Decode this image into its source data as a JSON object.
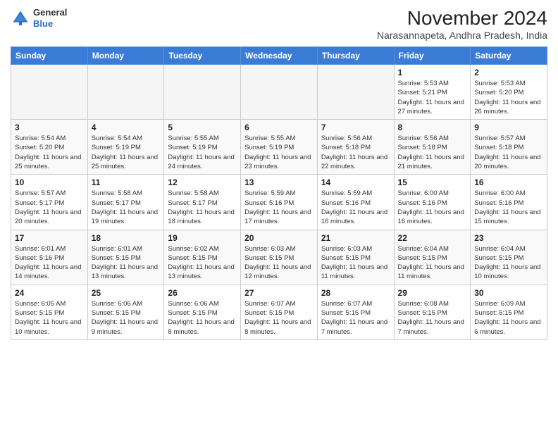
{
  "header": {
    "logo": {
      "general": "General",
      "blue": "Blue"
    },
    "month_title": "November 2024",
    "location": "Narasannapeta, Andhra Pradesh, India"
  },
  "weekdays": [
    "Sunday",
    "Monday",
    "Tuesday",
    "Wednesday",
    "Thursday",
    "Friday",
    "Saturday"
  ],
  "weeks": [
    [
      {
        "day": "",
        "sunrise": "",
        "sunset": "",
        "daylight": "",
        "empty": true
      },
      {
        "day": "",
        "sunrise": "",
        "sunset": "",
        "daylight": "",
        "empty": true
      },
      {
        "day": "",
        "sunrise": "",
        "sunset": "",
        "daylight": "",
        "empty": true
      },
      {
        "day": "",
        "sunrise": "",
        "sunset": "",
        "daylight": "",
        "empty": true
      },
      {
        "day": "",
        "sunrise": "",
        "sunset": "",
        "daylight": "",
        "empty": true
      },
      {
        "day": "1",
        "sunrise": "Sunrise: 5:53 AM",
        "sunset": "Sunset: 5:21 PM",
        "daylight": "Daylight: 11 hours and 27 minutes.",
        "empty": false
      },
      {
        "day": "2",
        "sunrise": "Sunrise: 5:53 AM",
        "sunset": "Sunset: 5:20 PM",
        "daylight": "Daylight: 11 hours and 26 minutes.",
        "empty": false
      }
    ],
    [
      {
        "day": "3",
        "sunrise": "Sunrise: 5:54 AM",
        "sunset": "Sunset: 5:20 PM",
        "daylight": "Daylight: 11 hours and 25 minutes.",
        "empty": false
      },
      {
        "day": "4",
        "sunrise": "Sunrise: 5:54 AM",
        "sunset": "Sunset: 5:19 PM",
        "daylight": "Daylight: 11 hours and 25 minutes.",
        "empty": false
      },
      {
        "day": "5",
        "sunrise": "Sunrise: 5:55 AM",
        "sunset": "Sunset: 5:19 PM",
        "daylight": "Daylight: 11 hours and 24 minutes.",
        "empty": false
      },
      {
        "day": "6",
        "sunrise": "Sunrise: 5:55 AM",
        "sunset": "Sunset: 5:19 PM",
        "daylight": "Daylight: 11 hours and 23 minutes.",
        "empty": false
      },
      {
        "day": "7",
        "sunrise": "Sunrise: 5:56 AM",
        "sunset": "Sunset: 5:18 PM",
        "daylight": "Daylight: 11 hours and 22 minutes.",
        "empty": false
      },
      {
        "day": "8",
        "sunrise": "Sunrise: 5:56 AM",
        "sunset": "Sunset: 5:18 PM",
        "daylight": "Daylight: 11 hours and 21 minutes.",
        "empty": false
      },
      {
        "day": "9",
        "sunrise": "Sunrise: 5:57 AM",
        "sunset": "Sunset: 5:18 PM",
        "daylight": "Daylight: 11 hours and 20 minutes.",
        "empty": false
      }
    ],
    [
      {
        "day": "10",
        "sunrise": "Sunrise: 5:57 AM",
        "sunset": "Sunset: 5:17 PM",
        "daylight": "Daylight: 11 hours and 20 minutes.",
        "empty": false
      },
      {
        "day": "11",
        "sunrise": "Sunrise: 5:58 AM",
        "sunset": "Sunset: 5:17 PM",
        "daylight": "Daylight: 11 hours and 19 minutes.",
        "empty": false
      },
      {
        "day": "12",
        "sunrise": "Sunrise: 5:58 AM",
        "sunset": "Sunset: 5:17 PM",
        "daylight": "Daylight: 11 hours and 18 minutes.",
        "empty": false
      },
      {
        "day": "13",
        "sunrise": "Sunrise: 5:59 AM",
        "sunset": "Sunset: 5:16 PM",
        "daylight": "Daylight: 11 hours and 17 minutes.",
        "empty": false
      },
      {
        "day": "14",
        "sunrise": "Sunrise: 5:59 AM",
        "sunset": "Sunset: 5:16 PM",
        "daylight": "Daylight: 11 hours and 16 minutes.",
        "empty": false
      },
      {
        "day": "15",
        "sunrise": "Sunrise: 6:00 AM",
        "sunset": "Sunset: 5:16 PM",
        "daylight": "Daylight: 11 hours and 16 minutes.",
        "empty": false
      },
      {
        "day": "16",
        "sunrise": "Sunrise: 6:00 AM",
        "sunset": "Sunset: 5:16 PM",
        "daylight": "Daylight: 11 hours and 15 minutes.",
        "empty": false
      }
    ],
    [
      {
        "day": "17",
        "sunrise": "Sunrise: 6:01 AM",
        "sunset": "Sunset: 5:16 PM",
        "daylight": "Daylight: 11 hours and 14 minutes.",
        "empty": false
      },
      {
        "day": "18",
        "sunrise": "Sunrise: 6:01 AM",
        "sunset": "Sunset: 5:15 PM",
        "daylight": "Daylight: 11 hours and 13 minutes.",
        "empty": false
      },
      {
        "day": "19",
        "sunrise": "Sunrise: 6:02 AM",
        "sunset": "Sunset: 5:15 PM",
        "daylight": "Daylight: 11 hours and 13 minutes.",
        "empty": false
      },
      {
        "day": "20",
        "sunrise": "Sunrise: 6:03 AM",
        "sunset": "Sunset: 5:15 PM",
        "daylight": "Daylight: 11 hours and 12 minutes.",
        "empty": false
      },
      {
        "day": "21",
        "sunrise": "Sunrise: 6:03 AM",
        "sunset": "Sunset: 5:15 PM",
        "daylight": "Daylight: 11 hours and 11 minutes.",
        "empty": false
      },
      {
        "day": "22",
        "sunrise": "Sunrise: 6:04 AM",
        "sunset": "Sunset: 5:15 PM",
        "daylight": "Daylight: 11 hours and 11 minutes.",
        "empty": false
      },
      {
        "day": "23",
        "sunrise": "Sunrise: 6:04 AM",
        "sunset": "Sunset: 5:15 PM",
        "daylight": "Daylight: 11 hours and 10 minutes.",
        "empty": false
      }
    ],
    [
      {
        "day": "24",
        "sunrise": "Sunrise: 6:05 AM",
        "sunset": "Sunset: 5:15 PM",
        "daylight": "Daylight: 11 hours and 10 minutes.",
        "empty": false
      },
      {
        "day": "25",
        "sunrise": "Sunrise: 6:06 AM",
        "sunset": "Sunset: 5:15 PM",
        "daylight": "Daylight: 11 hours and 9 minutes.",
        "empty": false
      },
      {
        "day": "26",
        "sunrise": "Sunrise: 6:06 AM",
        "sunset": "Sunset: 5:15 PM",
        "daylight": "Daylight: 11 hours and 8 minutes.",
        "empty": false
      },
      {
        "day": "27",
        "sunrise": "Sunrise: 6:07 AM",
        "sunset": "Sunset: 5:15 PM",
        "daylight": "Daylight: 11 hours and 8 minutes.",
        "empty": false
      },
      {
        "day": "28",
        "sunrise": "Sunrise: 6:07 AM",
        "sunset": "Sunset: 5:15 PM",
        "daylight": "Daylight: 11 hours and 7 minutes.",
        "empty": false
      },
      {
        "day": "29",
        "sunrise": "Sunrise: 6:08 AM",
        "sunset": "Sunset: 5:15 PM",
        "daylight": "Daylight: 11 hours and 7 minutes.",
        "empty": false
      },
      {
        "day": "30",
        "sunrise": "Sunrise: 6:09 AM",
        "sunset": "Sunset: 5:15 PM",
        "daylight": "Daylight: 11 hours and 6 minutes.",
        "empty": false
      }
    ]
  ]
}
